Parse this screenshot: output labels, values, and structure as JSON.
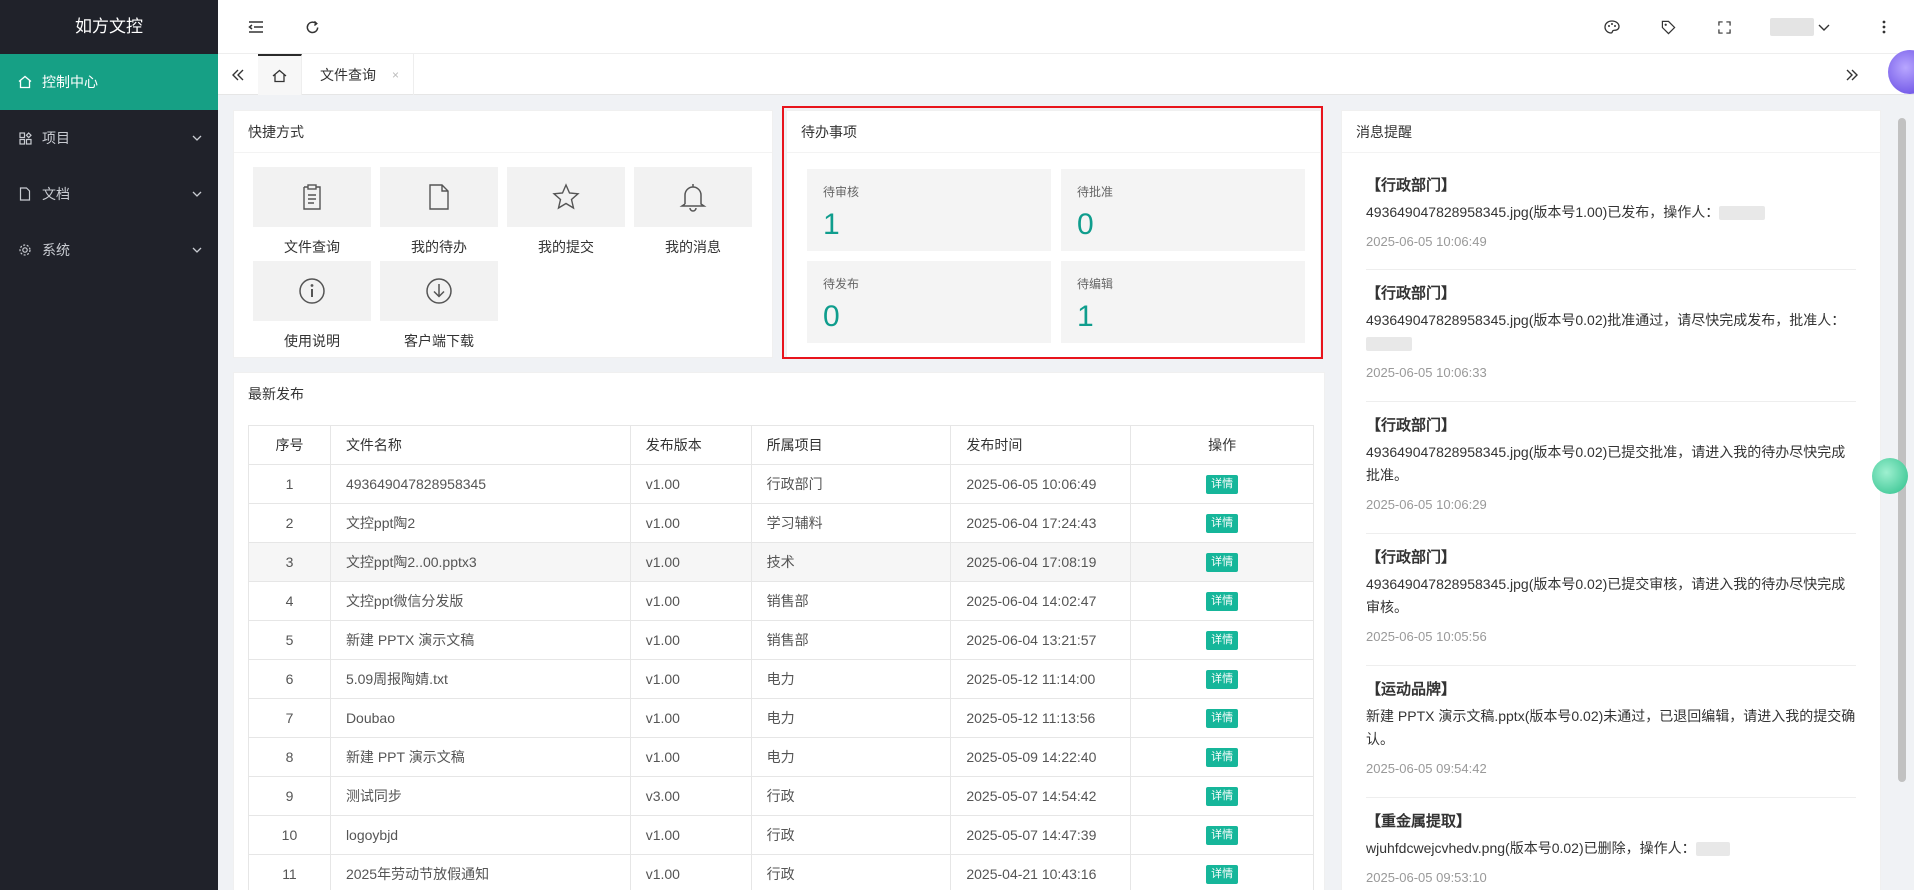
{
  "sidebar": {
    "brand": "如方文控",
    "items": [
      {
        "label": "控制中心",
        "icon": "home-icon"
      },
      {
        "label": "项目",
        "icon": "project-icon"
      },
      {
        "label": "文档",
        "icon": "document-icon"
      },
      {
        "label": "系统",
        "icon": "gear-icon"
      }
    ]
  },
  "header": {
    "icons": [
      "menu-fold-icon",
      "refresh-icon",
      "palette-icon",
      "tag-icon",
      "fullscreen-icon",
      "more-icon"
    ]
  },
  "tabs": {
    "items": [
      {
        "label": "文件查询",
        "close": "×"
      }
    ]
  },
  "quick": {
    "title": "快捷方式",
    "items": [
      {
        "label": "文件查询",
        "icon": "file-search-icon"
      },
      {
        "label": "我的待办",
        "icon": "file-icon"
      },
      {
        "label": "我的提交",
        "icon": "star-icon"
      },
      {
        "label": "我的消息",
        "icon": "bell-icon"
      },
      {
        "label": "使用说明",
        "icon": "info-icon"
      },
      {
        "label": "客户端下载",
        "icon": "download-icon"
      }
    ]
  },
  "todo": {
    "title": "待办事项",
    "items": [
      {
        "label": "待审核",
        "value": "1"
      },
      {
        "label": "待批准",
        "value": "0"
      },
      {
        "label": "待发布",
        "value": "0"
      },
      {
        "label": "待编辑",
        "value": "1"
      }
    ]
  },
  "latest": {
    "title": "最新发布",
    "columns": [
      "序号",
      "文件名称",
      "发布版本",
      "所属项目",
      "发布时间",
      "操作"
    ],
    "detail_label": "详情",
    "rows": [
      {
        "no": "1",
        "name": "493649047828958345",
        "ver": "v1.00",
        "proj": "行政部门",
        "time": "2025-06-05 10:06:49"
      },
      {
        "no": "2",
        "name": "文控ppt陶2",
        "ver": "v1.00",
        "proj": "学习辅料",
        "time": "2025-06-04 17:24:43"
      },
      {
        "no": "3",
        "name": "文控ppt陶2..00.pptx3",
        "ver": "v1.00",
        "proj": "技术",
        "time": "2025-06-04 17:08:19"
      },
      {
        "no": "4",
        "name": "文控ppt微信分发版",
        "ver": "v1.00",
        "proj": "销售部",
        "time": "2025-06-04 14:02:47"
      },
      {
        "no": "5",
        "name": "新建 PPTX 演示文稿",
        "ver": "v1.00",
        "proj": "销售部",
        "time": "2025-06-04 13:21:57"
      },
      {
        "no": "6",
        "name": "5.09周报陶婧.txt",
        "ver": "v1.00",
        "proj": "电力",
        "time": "2025-05-12 11:14:00"
      },
      {
        "no": "7",
        "name": "Doubao",
        "ver": "v1.00",
        "proj": "电力",
        "time": "2025-05-12 11:13:56"
      },
      {
        "no": "8",
        "name": "新建 PPT 演示文稿",
        "ver": "v1.00",
        "proj": "电力",
        "time": "2025-05-09 14:22:40"
      },
      {
        "no": "9",
        "name": "测试同步",
        "ver": "v3.00",
        "proj": "行政",
        "time": "2025-05-07 14:54:42"
      },
      {
        "no": "10",
        "name": "logoybjd",
        "ver": "v1.00",
        "proj": "行政",
        "time": "2025-05-07 14:47:39"
      },
      {
        "no": "11",
        "name": "2025年劳动节放假通知",
        "ver": "v1.00",
        "proj": "行政",
        "time": "2025-04-21 10:43:16"
      }
    ]
  },
  "messages": {
    "title": "消息提醒",
    "items": [
      {
        "dept": "【行政部门】",
        "text": "493649047828958345.jpg(版本号1.00)已发布，操作人：",
        "time": "2025-06-05 10:06:49"
      },
      {
        "dept": "【行政部门】",
        "text": "493649047828958345.jpg(版本号0.02)批准通过，请尽快完成发布，批准人：",
        "time": "2025-06-05 10:06:33"
      },
      {
        "dept": "【行政部门】",
        "text": "493649047828958345.jpg(版本号0.02)已提交批准，请进入我的待办尽快完成批准。",
        "time": "2025-06-05 10:06:29"
      },
      {
        "dept": "【行政部门】",
        "text": "493649047828958345.jpg(版本号0.02)已提交审核，请进入我的待办尽快完成审核。",
        "time": "2025-06-05 10:05:56"
      },
      {
        "dept": "【运动品牌】",
        "text": "新建 PPTX 演示文稿.pptx(版本号0.02)未通过，已退回编辑，请进入我的提交确认。",
        "time": "2025-06-05 09:54:42"
      },
      {
        "dept": "【重金属提取】",
        "text": "wjuhfdcwejcvhedv.png(版本号0.02)已删除，操作人：",
        "time": "2025-06-05 09:53:10"
      }
    ]
  }
}
